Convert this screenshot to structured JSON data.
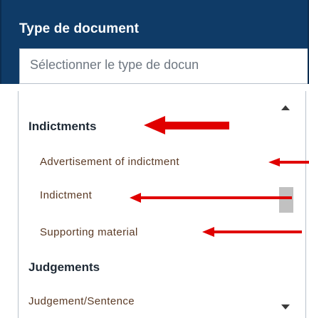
{
  "header": {
    "title": "Type de document"
  },
  "select": {
    "placeholder": "Sélectionner le type de docun"
  },
  "dropdown": {
    "groups": [
      {
        "label": "Indictments",
        "options": [
          {
            "label": "Advertisement of indictment"
          },
          {
            "label": "Indictment"
          },
          {
            "label": "Supporting material"
          }
        ]
      },
      {
        "label": "Judgements",
        "options": [
          {
            "label": "Judgement/Sentence"
          }
        ]
      }
    ]
  },
  "colors": {
    "header_bg": "#0f3b67",
    "arrow": "#e00000",
    "scroll_thumb": "#c1c1c1"
  },
  "icons": {
    "scroll_up": "triangle-up",
    "scroll_down": "triangle-down",
    "annotation": "red-arrow-left"
  }
}
